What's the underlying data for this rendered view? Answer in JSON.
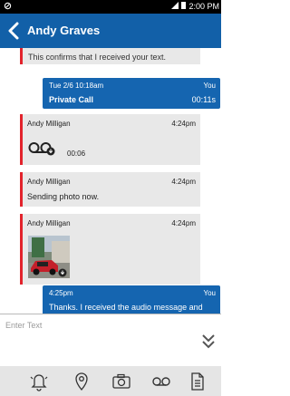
{
  "status_bar": {
    "time": "2:00 PM"
  },
  "header": {
    "contact_name": "Andy Graves"
  },
  "messages": [
    {
      "type": "incoming",
      "text": "This confirms that I received your text."
    },
    {
      "type": "outgoing",
      "date": "Tue 2/6 10:18am",
      "sender": "You",
      "text": "Private Call",
      "duration": "00:11s"
    },
    {
      "type": "incoming",
      "sender": "Andy Milligan",
      "time": "4:24pm",
      "audio_duration": "00:06"
    },
    {
      "type": "incoming",
      "sender": "Andy Milligan",
      "time": "4:24pm",
      "text": "Sending photo now."
    },
    {
      "type": "incoming",
      "sender": "Andy Milligan",
      "time": "4:24pm"
    },
    {
      "type": "outgoing",
      "time": "4:25pm",
      "sender": "You",
      "text": "Thanks. I received the audio message and"
    }
  ],
  "compose": {
    "placeholder": "Enter Text"
  },
  "toolbar": [
    "alert-icon",
    "location-icon",
    "camera-icon",
    "voicemail-icon",
    "document-icon"
  ],
  "colors": {
    "brand": "#1260a8",
    "outgoing": "#1565b0",
    "incoming_accent": "#e2232c",
    "incoming_bg": "#e8e8e8"
  }
}
